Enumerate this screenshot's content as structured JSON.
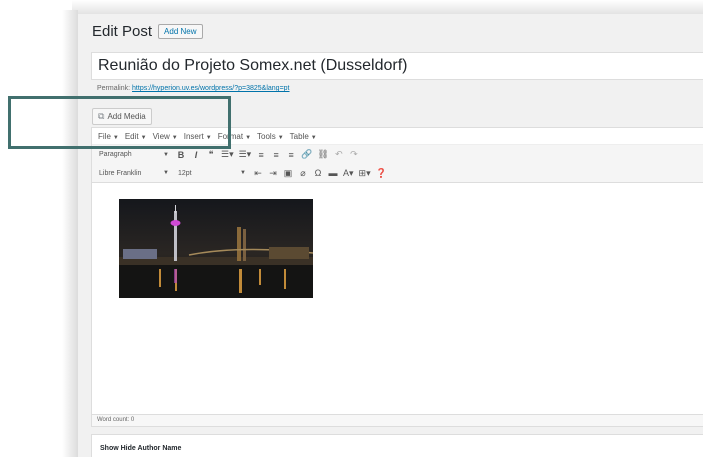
{
  "header": {
    "title": "Edit Post",
    "add_new": "Add New"
  },
  "post": {
    "title": "Reunião do Projeto Somex.net (Dusseldorf)",
    "permalink_label": "Permalink:",
    "permalink_url": "https://hyperion.uv.es/wordpress/?p=3825&lang=pt"
  },
  "media": {
    "add_media": "Add Media",
    "icon": "media-icon"
  },
  "menubar": [
    {
      "label": "File"
    },
    {
      "label": "Edit"
    },
    {
      "label": "View"
    },
    {
      "label": "Insert"
    },
    {
      "label": "Format"
    },
    {
      "label": "Tools"
    },
    {
      "label": "Table"
    }
  ],
  "toolbar1": {
    "format_select": "Paragraph",
    "buttons": [
      {
        "name": "bold-icon",
        "glyph": "B"
      },
      {
        "name": "italic-icon",
        "glyph": "I"
      },
      {
        "name": "blockquote-icon",
        "glyph": "❝"
      },
      {
        "name": "bullet-list-icon",
        "glyph": "☰▾"
      },
      {
        "name": "numbered-list-icon",
        "glyph": "☰▾"
      },
      {
        "name": "align-left-icon",
        "glyph": "≡"
      },
      {
        "name": "align-center-icon",
        "glyph": "≡"
      },
      {
        "name": "align-right-icon",
        "glyph": "≡"
      },
      {
        "name": "link-icon",
        "glyph": "🔗"
      },
      {
        "name": "unlink-icon",
        "glyph": "⛓"
      },
      {
        "name": "undo-icon",
        "glyph": "↶"
      },
      {
        "name": "redo-icon",
        "glyph": "↷"
      }
    ]
  },
  "toolbar2": {
    "font_select": "Libre Franklin",
    "size_select": "12pt",
    "buttons": [
      {
        "name": "outdent-icon",
        "glyph": "⇤"
      },
      {
        "name": "indent-icon",
        "glyph": "⇥"
      },
      {
        "name": "paste-text-icon",
        "glyph": "▣"
      },
      {
        "name": "clear-formatting-icon",
        "glyph": "⌀"
      },
      {
        "name": "special-char-icon",
        "glyph": "Ω"
      },
      {
        "name": "horizontal-rule-icon",
        "glyph": "▬"
      },
      {
        "name": "text-color-icon",
        "glyph": "A▾"
      },
      {
        "name": "table-icon",
        "glyph": "⊞▾"
      },
      {
        "name": "help-icon",
        "glyph": "❓"
      }
    ]
  },
  "editor": {
    "word_count": "Word count: 0"
  },
  "metabox": {
    "title": "Show Hide Author Name"
  },
  "colors": {
    "link": "#0073aa",
    "highlight": "#41706e",
    "background": "#f1f1f1"
  }
}
